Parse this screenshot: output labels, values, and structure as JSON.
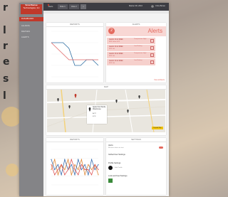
{
  "background": {
    "side_text": [
      "r",
      "l",
      "r",
      "e",
      "s",
      "l"
    ]
  },
  "sidebar": {
    "logo_line1": "SmartSense",
    "logo_line2": "Technologies, Inc",
    "items": [
      {
        "label": "DASHBOARD",
        "active": true
      },
      {
        "label": "ALLDATA"
      },
      {
        "label": "DEVICES"
      },
      {
        "label": "ALERTS"
      }
    ]
  },
  "topbar": {
    "tabs": [
      "Alerts",
      "Role 1",
      "Role 2"
    ],
    "date": "Marker 08, 2016",
    "user": "Chris Brown",
    "accent": "#c0392b"
  },
  "panels": {
    "reports_title": "REPORTS",
    "alerts_title": "ALERTS",
    "map_title": "MAP",
    "report2_title": "REPORTS",
    "settings_title": "SETTINGS"
  },
  "alerts": {
    "count": "2",
    "heading": "Alerts",
    "items": [
      {
        "title": "Austin Fruit Walk",
        "sub": "98°F   4d  at 4:22",
        "right": "Temperature High"
      },
      {
        "title": "Austin Fruit Walk",
        "sub": "38°F   4d",
        "right": "Low Battery"
      },
      {
        "title": "Austin Fruit Walk",
        "sub": "38°F   4d",
        "right": "Temperature High"
      },
      {
        "title": "Austin Fruit Walk",
        "sub": "38°F   4d",
        "right": "Low Battery"
      }
    ],
    "view_all": "View all Alerts"
  },
  "map": {
    "popup_title": "Apple Fruit Sterile Warehouse",
    "popup_val1": "ACTI",
    "popup_val2": "42°F",
    "expand": "Expand Map"
  },
  "settings": {
    "alerts_label": "Alerts",
    "alerts_sub": "Receive alerts via text",
    "global_label": "Global User Settings",
    "profile_label": "Profile Settings",
    "profile_sub": "Edit Profile",
    "look_label": "Look and Feel Settings"
  },
  "chart_data": [
    {
      "type": "line",
      "series": [
        {
          "values": [
            6,
            6,
            6,
            5,
            2,
            2,
            3,
            3,
            2
          ]
        },
        {
          "values": [
            6,
            5,
            4,
            3,
            3,
            3,
            3,
            3,
            3
          ]
        }
      ],
      "colors": [
        "#2f6fa3",
        "#e06666"
      ]
    },
    {
      "type": "line",
      "series": [
        {
          "values": [
            3,
            5,
            2,
            4,
            3,
            5,
            2,
            4,
            3,
            5,
            2,
            4,
            3,
            4,
            2
          ]
        },
        {
          "values": [
            5,
            3,
            4,
            2,
            5,
            3,
            4,
            2,
            5,
            3,
            4,
            2,
            5,
            3,
            4
          ]
        },
        {
          "values": [
            4,
            2,
            3,
            4,
            2,
            3,
            5,
            3,
            2,
            4,
            3,
            3,
            2,
            4,
            3
          ]
        }
      ],
      "colors": [
        "#e08a3a",
        "#3a6fb0",
        "#d55"
      ]
    }
  ]
}
